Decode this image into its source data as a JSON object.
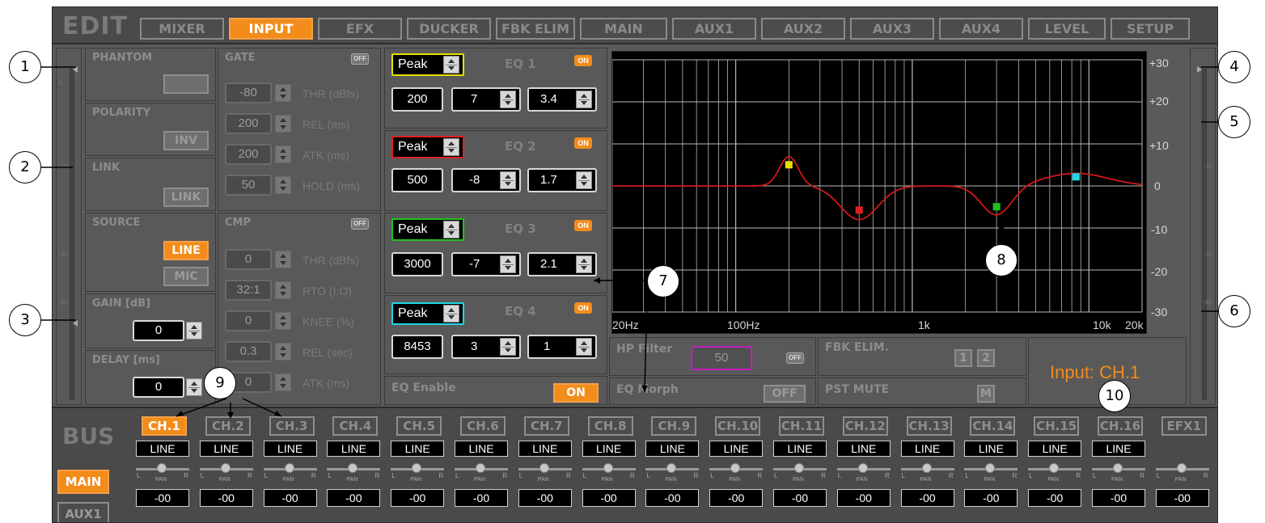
{
  "app": {
    "edit_label": "EDIT",
    "tabs": [
      {
        "label": "MIXER",
        "active": false
      },
      {
        "label": "INPUT",
        "active": true
      },
      {
        "label": "EFX",
        "active": false
      },
      {
        "label": "DUCKER",
        "active": false
      },
      {
        "label": "FBK ELIM",
        "active": false
      },
      {
        "label": "MAIN",
        "active": false
      },
      {
        "label": "AUX1",
        "active": false
      },
      {
        "label": "AUX2",
        "active": false
      },
      {
        "label": "AUX3",
        "active": false
      },
      {
        "label": "AUX4",
        "active": false
      },
      {
        "label": "LEVEL",
        "active": false
      },
      {
        "label": "SETUP",
        "active": false
      }
    ],
    "colors": {
      "accent": "#f28c1b",
      "panel": "#595959",
      "background": "#4a4a4a"
    }
  },
  "input_meter": {
    "ticks": [
      "0",
      "-10-",
      "-30-",
      "-60-"
    ]
  },
  "output_meter": {
    "ticks": [
      "-10-",
      "-30-",
      "-60-"
    ]
  },
  "left": {
    "phantom_label": "PHANTOM",
    "polarity_label": "POLARITY",
    "inv_button": "INV",
    "link_label": "LINK",
    "link_button": "LINK",
    "source_label": "SOURCE",
    "line_button": "LINE",
    "mic_button": "MIC",
    "gain_label": "GAIN [dB]",
    "gain_value": "0",
    "delay_label": "DELAY [ms]",
    "delay_value": "0"
  },
  "gate": {
    "title": "GATE",
    "status": "OFF",
    "rows": [
      {
        "value": "-80",
        "unit": "THR (dBfs)"
      },
      {
        "value": "200",
        "unit": "REL (ms)"
      },
      {
        "value": "200",
        "unit": "ATK (ms)"
      },
      {
        "value": "50",
        "unit": "HOLD (ms)"
      }
    ]
  },
  "cmp": {
    "title": "CMP",
    "status": "OFF",
    "rows": [
      {
        "value": "0",
        "unit": "THR (dBfs)"
      },
      {
        "value": "32:1",
        "unit": "RTO (I:O)"
      },
      {
        "value": "0",
        "unit": "KNEE (%)"
      },
      {
        "value": "0.3",
        "unit": "REL (sec)"
      },
      {
        "value": "0",
        "unit": "ATK (ms)"
      }
    ]
  },
  "eq": {
    "bands": [
      {
        "title": "EQ 1",
        "type": "Peak",
        "status": "ON",
        "freq": "200",
        "gain": "7",
        "q": "3.4",
        "color": "#e8e000"
      },
      {
        "title": "EQ 2",
        "type": "Peak",
        "status": "ON",
        "freq": "500",
        "gain": "-8",
        "q": "1.7",
        "color": "#e02020"
      },
      {
        "title": "EQ 3",
        "type": "Peak",
        "status": "ON",
        "freq": "3000",
        "gain": "-7",
        "q": "2.1",
        "color": "#20c020"
      },
      {
        "title": "EQ 4",
        "type": "Peak",
        "status": "ON",
        "freq": "8453",
        "gain": "3",
        "q": "1",
        "color": "#20d8e8"
      }
    ],
    "enable_label": "EQ Enable",
    "enable_value": "ON"
  },
  "graph": {
    "y_labels": [
      "+30",
      "+20",
      "+10",
      "0",
      "-10",
      "-20",
      "-30"
    ],
    "x_labels": [
      "20Hz",
      "100Hz",
      "1k",
      "10k",
      "20k"
    ]
  },
  "lower": {
    "hp_filter_label": "HP Filter",
    "hp_filter_value": "50",
    "hp_filter_status": "OFF",
    "eq_morph_label": "EQ Morph",
    "eq_morph_value": "OFF",
    "fbk_elim_label": "FBK ELIM.",
    "fbk_btn_1": "1",
    "fbk_btn_2": "2",
    "pst_mute_label": "PST MUTE",
    "pst_mute_btn": "M",
    "input_name": "Input: CH.1"
  },
  "bus": {
    "label": "BUS",
    "main_button": "MAIN",
    "aux1_button": "AUX1",
    "pan_label": "PAN",
    "pan_l": "L",
    "pan_r": "R",
    "channels": [
      {
        "name": "CH.1",
        "source": "LINE",
        "level": "-00",
        "active": true
      },
      {
        "name": "CH.2",
        "source": "LINE",
        "level": "-00",
        "active": false
      },
      {
        "name": "CH.3",
        "source": "LINE",
        "level": "-00",
        "active": false
      },
      {
        "name": "CH.4",
        "source": "LINE",
        "level": "-00",
        "active": false
      },
      {
        "name": "CH.5",
        "source": "LINE",
        "level": "-00",
        "active": false
      },
      {
        "name": "CH.6",
        "source": "LINE",
        "level": "-00",
        "active": false
      },
      {
        "name": "CH.7",
        "source": "LINE",
        "level": "-00",
        "active": false
      },
      {
        "name": "CH.8",
        "source": "LINE",
        "level": "-00",
        "active": false
      },
      {
        "name": "CH.9",
        "source": "LINE",
        "level": "-00",
        "active": false
      },
      {
        "name": "CH.10",
        "source": "LINE",
        "level": "-00",
        "active": false
      },
      {
        "name": "CH.11",
        "source": "LINE",
        "level": "-00",
        "active": false
      },
      {
        "name": "CH.12",
        "source": "LINE",
        "level": "-00",
        "active": false
      },
      {
        "name": "CH.13",
        "source": "LINE",
        "level": "-00",
        "active": false
      },
      {
        "name": "CH.14",
        "source": "LINE",
        "level": "-00",
        "active": false
      },
      {
        "name": "CH.15",
        "source": "LINE",
        "level": "-00",
        "active": false
      },
      {
        "name": "CH.16",
        "source": "LINE",
        "level": "-00",
        "active": false
      },
      {
        "name": "EFX1",
        "source": "",
        "level": "-00",
        "active": false
      }
    ]
  },
  "callouts": [
    "1",
    "2",
    "3",
    "4",
    "5",
    "6",
    "7",
    "8",
    "9",
    "10"
  ]
}
